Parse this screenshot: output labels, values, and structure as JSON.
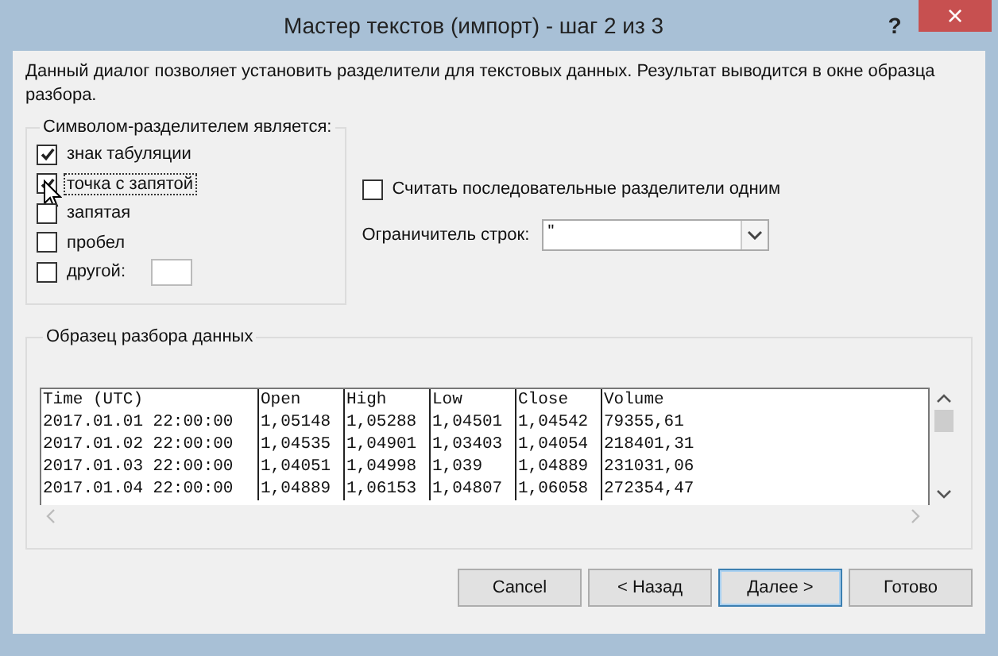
{
  "window": {
    "title": "Мастер текстов (импорт) - шаг 2 из 3",
    "help": "?",
    "close": "×"
  },
  "description": "Данный диалог позволяет установить разделители для текстовых данных. Результат выводится в окне образца разбора.",
  "delimiters": {
    "title": "Символом-разделителем является:",
    "options": [
      {
        "label": "знак табуляции",
        "checked": true
      },
      {
        "label": "точка с запятой",
        "checked": true,
        "focused": true
      },
      {
        "label": "запятая",
        "checked": false
      },
      {
        "label": "пробел",
        "checked": false
      },
      {
        "label": "другой:",
        "checked": false,
        "kind": "other"
      }
    ]
  },
  "treat_consecutive": {
    "label": "Считать последовательные разделители одним",
    "checked": false
  },
  "text_qualifier": {
    "label": "Ограничитель строк:",
    "value": "\""
  },
  "preview": {
    "title": "Образец разбора данных",
    "columns": [
      "Time (UTC)",
      "Open",
      "High",
      "Low",
      "Close",
      "Volume"
    ],
    "rows": [
      [
        "2017.01.01 22:00:00",
        "1,05148",
        "1,05288",
        "1,04501",
        "1,04542",
        "79355,61"
      ],
      [
        "2017.01.02 22:00:00",
        "1,04535",
        "1,04901",
        "1,03403",
        "1,04054",
        "218401,31"
      ],
      [
        "2017.01.03 22:00:00",
        "1,04051",
        "1,04998",
        "1,039",
        "1,04889",
        "231031,06"
      ],
      [
        "2017.01.04 22:00:00",
        "1,04889",
        "1,06153",
        "1,04807",
        "1,06058",
        "272354,47"
      ]
    ]
  },
  "buttons": [
    {
      "label": "Cancel",
      "default": false
    },
    {
      "label": "< Назад",
      "default": false
    },
    {
      "label": "Далее >",
      "default": true
    },
    {
      "label": "Готово",
      "default": false
    }
  ]
}
